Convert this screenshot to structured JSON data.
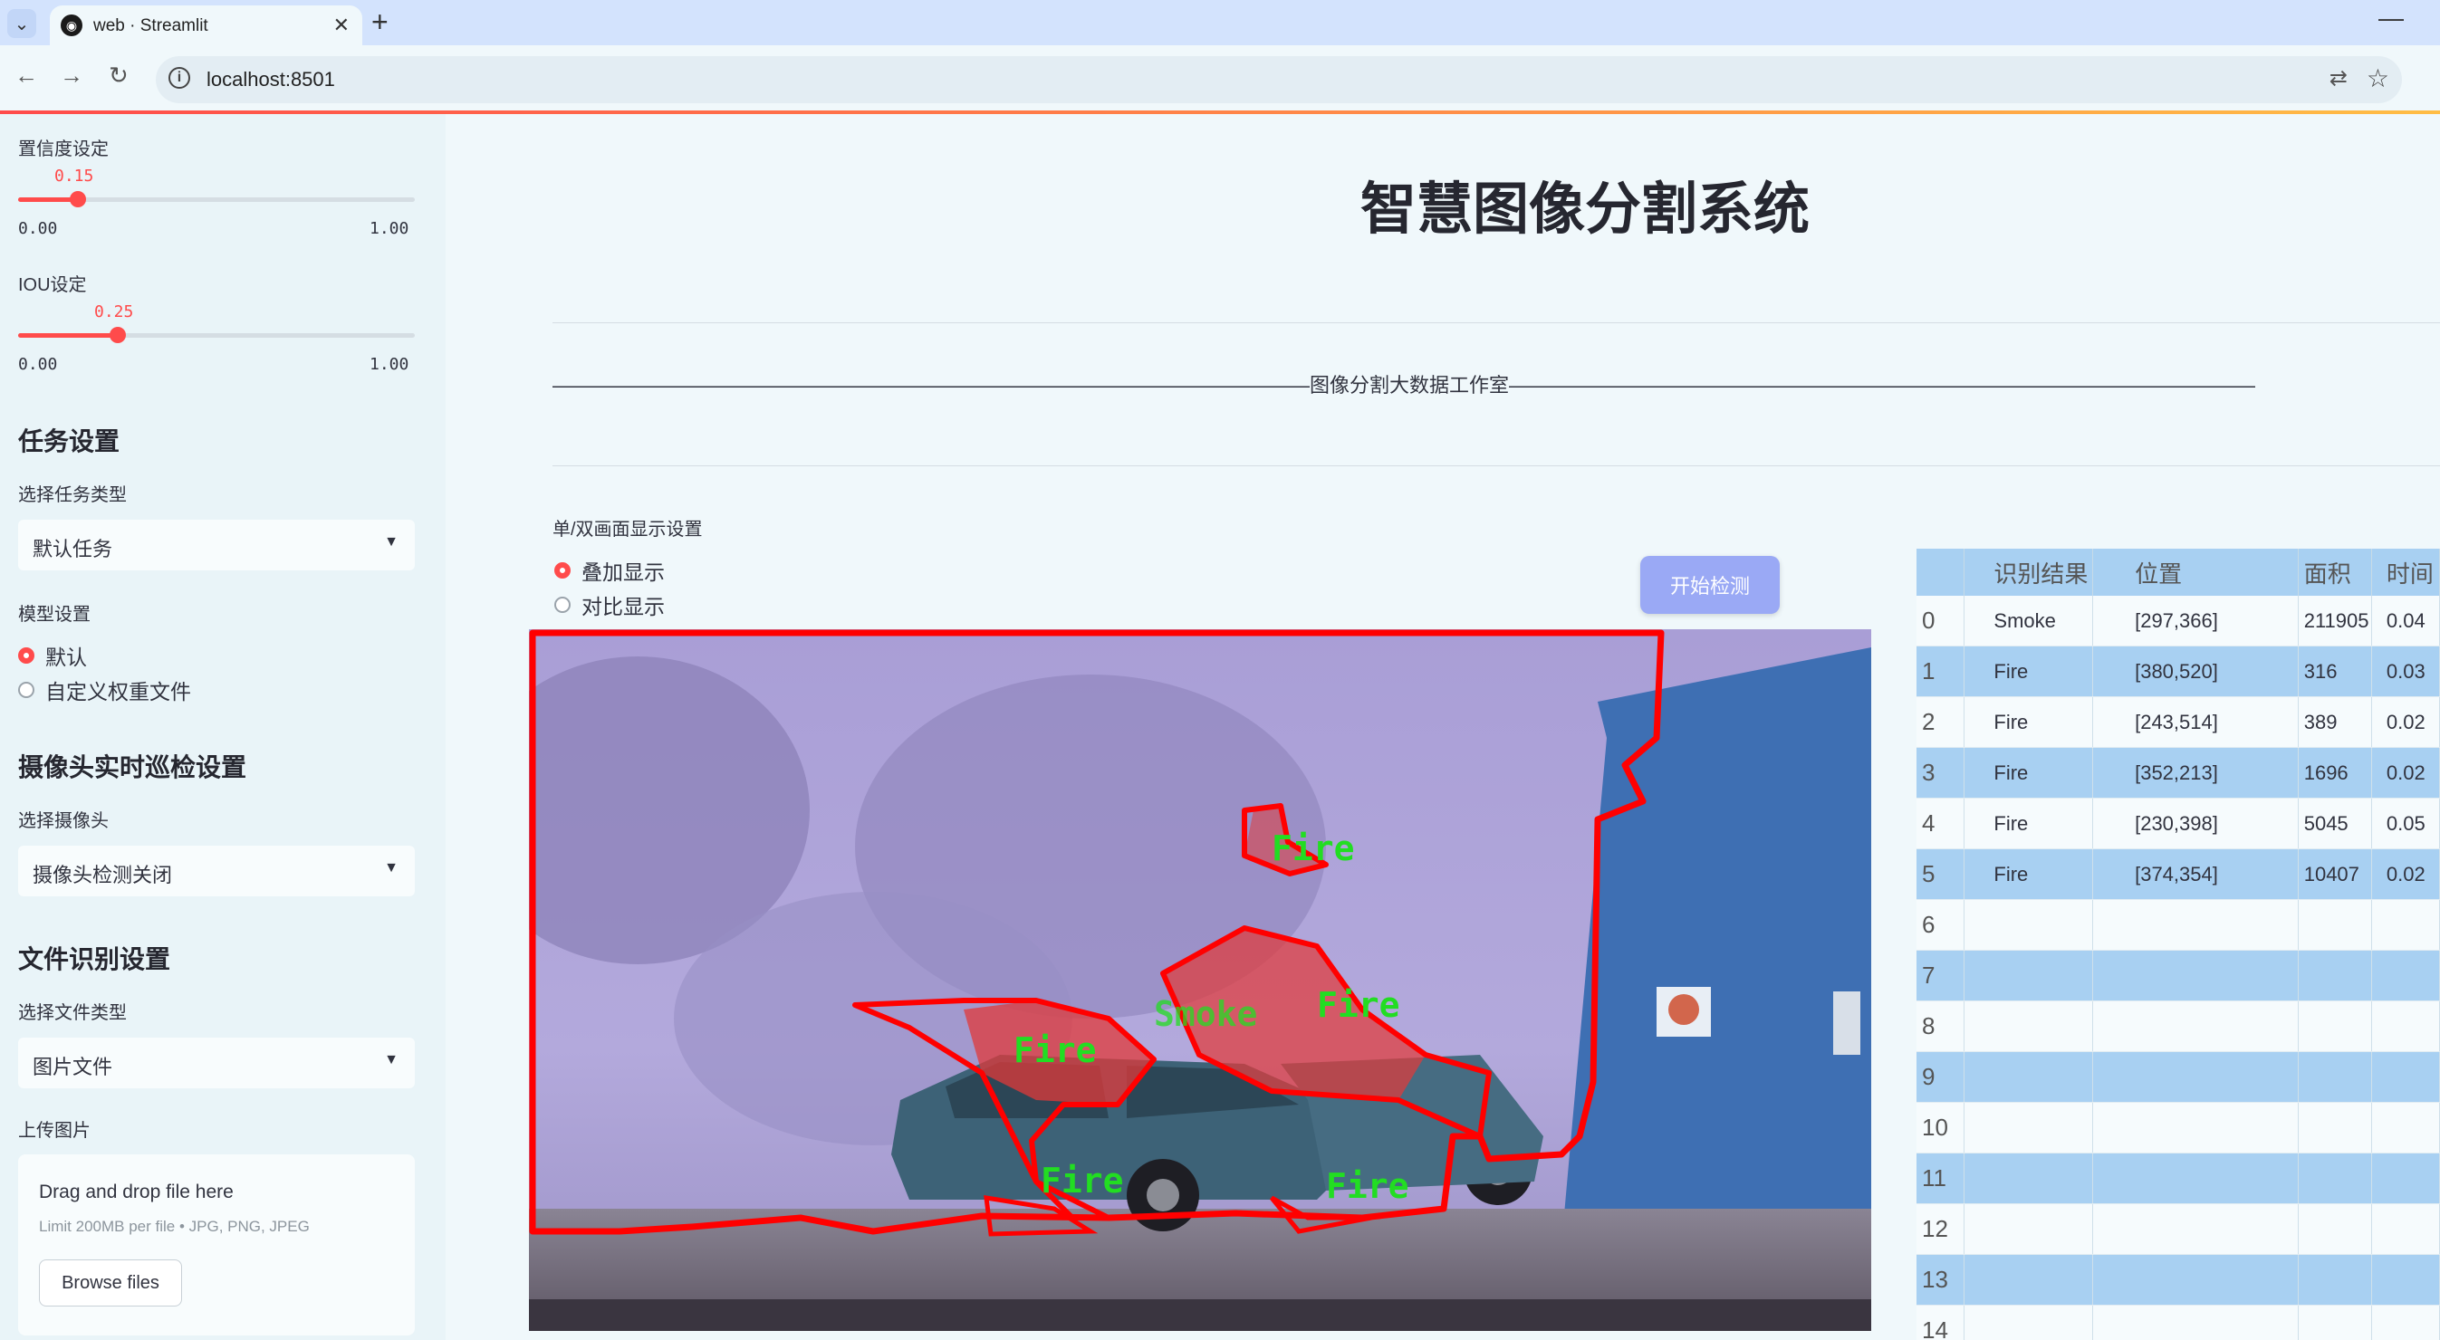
{
  "browser": {
    "tab_title": "web · Streamlit",
    "url": "localhost:8501"
  },
  "sidebar": {
    "confidence": {
      "label": "置信度设定",
      "value": "0.15",
      "min": "0.00",
      "max": "1.00",
      "fraction": 0.15
    },
    "iou": {
      "label": "IOU设定",
      "value": "0.25",
      "min": "0.00",
      "max": "1.00",
      "fraction": 0.25
    },
    "task_header": "任务设置",
    "task_type_label": "选择任务类型",
    "task_type_value": "默认任务",
    "model_label": "模型设置",
    "model_options": [
      "默认",
      "自定义权重文件"
    ],
    "model_selected": 0,
    "camera_header": "摄像头实时巡检设置",
    "camera_label": "选择摄像头",
    "camera_value": "摄像头检测关闭",
    "file_header": "文件识别设置",
    "file_type_label": "选择文件类型",
    "file_type_value": "图片文件",
    "upload_label": "上传图片",
    "upload_title": "Drag and drop file here",
    "upload_limit": "Limit 200MB per file • JPG, PNG, JPEG",
    "browse_label": "Browse files"
  },
  "main": {
    "title": "智慧图像分割系统",
    "studio_line": "——————————————————————————————————————图像分割大数据工作室——————————————————————————————————————",
    "display_label": "单/双画面显示设置",
    "display_options": [
      "叠加显示",
      "对比显示"
    ],
    "display_selected": 0,
    "start_button": "开始检测",
    "detections": [
      {
        "label": "Fire"
      },
      {
        "label": "Smoke"
      },
      {
        "label": "Fire"
      },
      {
        "label": "Fire"
      },
      {
        "label": "Fire"
      },
      {
        "label": "Fire"
      }
    ]
  },
  "table": {
    "columns": [
      "",
      "识别结果",
      "位置",
      "面积",
      "时间"
    ],
    "rows": [
      [
        "0",
        "Smoke",
        "[297,366]",
        "211905",
        "0.04"
      ],
      [
        "1",
        "Fire",
        "[380,520]",
        "316",
        "0.03"
      ],
      [
        "2",
        "Fire",
        "[243,514]",
        "389",
        "0.02"
      ],
      [
        "3",
        "Fire",
        "[352,213]",
        "1696",
        "0.02"
      ],
      [
        "4",
        "Fire",
        "[230,398]",
        "5045",
        "0.05"
      ],
      [
        "5",
        "Fire",
        "[374,354]",
        "10407",
        "0.02"
      ],
      [
        "6",
        "",
        "",
        "",
        ""
      ],
      [
        "7",
        "",
        "",
        "",
        ""
      ],
      [
        "8",
        "",
        "",
        "",
        ""
      ],
      [
        "9",
        "",
        "",
        "",
        ""
      ],
      [
        "10",
        "",
        "",
        "",
        ""
      ],
      [
        "11",
        "",
        "",
        "",
        ""
      ],
      [
        "12",
        "",
        "",
        "",
        ""
      ],
      [
        "13",
        "",
        "",
        "",
        ""
      ],
      [
        "14",
        "",
        "",
        "",
        ""
      ]
    ]
  },
  "colors": {
    "accent": "#ff4b4b",
    "button": "#9aa9f5",
    "table_header": "#a8d0f2",
    "mask_outline": "#ff0000",
    "mask_label": "#22dd22"
  }
}
